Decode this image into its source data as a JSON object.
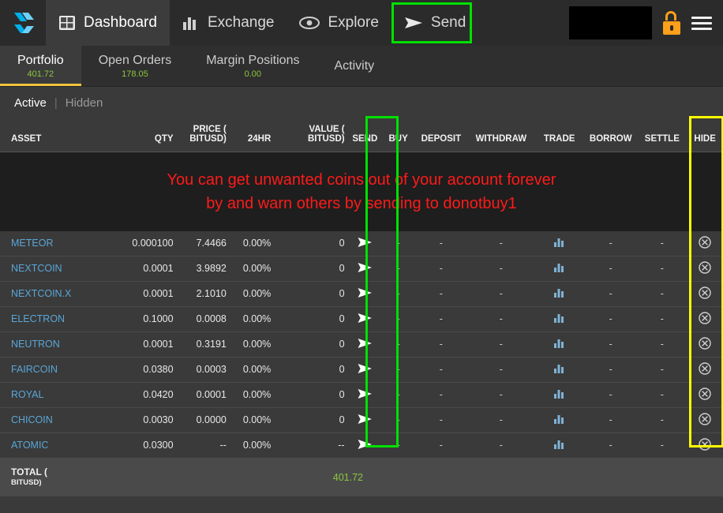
{
  "topbar": {
    "logo_icon": "bitshares-logo-icon",
    "nav": [
      {
        "label": "Dashboard",
        "icon": "dashboard-icon",
        "active": true
      },
      {
        "label": "Exchange",
        "icon": "bar-chart-icon",
        "active": false
      },
      {
        "label": "Explore",
        "icon": "eye-icon",
        "active": false
      },
      {
        "label": "Send",
        "icon": "send-arrow-icon",
        "active": false,
        "highlight": "#00e000"
      }
    ],
    "account_box": "",
    "lock_icon": "unlocked-padlock-icon",
    "menu_icon": "hamburger-menu-icon"
  },
  "tabs": [
    {
      "label": "Portfolio",
      "value": "401.72",
      "active": true
    },
    {
      "label": "Open Orders",
      "value": "178.05",
      "active": false
    },
    {
      "label": "Margin Positions",
      "value": "0.00",
      "active": false
    },
    {
      "label": "Activity",
      "value": "",
      "active": false
    }
  ],
  "subtabs": {
    "items": [
      {
        "label": "Active",
        "active": true
      },
      {
        "label": "Hidden",
        "active": false
      }
    ],
    "separator": "|"
  },
  "banner": {
    "line1": "You can get unwanted coins out of your account forever",
    "line2": "by and warn others by sending to  donotbuy1",
    "color": "#ff1a1a"
  },
  "table": {
    "columns": [
      {
        "key": "asset",
        "label": "ASSET",
        "align": "left"
      },
      {
        "key": "qty",
        "label": "QTY",
        "align": "right"
      },
      {
        "key": "price",
        "label": "PRICE (",
        "label2": "BITUSD)",
        "align": "right"
      },
      {
        "key": "hr24",
        "label": "24HR",
        "align": "right"
      },
      {
        "key": "value",
        "label": "VALUE (",
        "label2": "BITUSD)",
        "align": "right"
      },
      {
        "key": "send",
        "label": "SEND",
        "align": "center"
      },
      {
        "key": "buy",
        "label": "BUY",
        "align": "center"
      },
      {
        "key": "deposit",
        "label": "DEPOSIT",
        "align": "center"
      },
      {
        "key": "withdraw",
        "label": "WITHDRAW",
        "align": "center"
      },
      {
        "key": "trade",
        "label": "TRADE",
        "align": "center"
      },
      {
        "key": "borrow",
        "label": "BORROW",
        "align": "center"
      },
      {
        "key": "settle",
        "label": "SETTLE",
        "align": "center"
      },
      {
        "key": "hide",
        "label": "HIDE",
        "align": "center"
      }
    ],
    "rows": [
      {
        "asset": "METEOR",
        "qty": "0.000100",
        "price": "7.4466",
        "hr24": "0.00%",
        "value": "0",
        "send": "send-arrow-icon",
        "buy": "-",
        "deposit": "-",
        "withdraw": "-",
        "trade": "chart-icon",
        "borrow": "-",
        "settle": "-",
        "hide": "hide-circle-icon"
      },
      {
        "asset": "NEXTCOIN",
        "qty": "0.0001",
        "price": "3.9892",
        "hr24": "0.00%",
        "value": "0",
        "send": "send-arrow-icon",
        "buy": "-",
        "deposit": "-",
        "withdraw": "-",
        "trade": "chart-icon",
        "borrow": "-",
        "settle": "-",
        "hide": "hide-circle-icon"
      },
      {
        "asset": "NEXTCOIN.X",
        "qty": "0.0001",
        "price": "2.1010",
        "hr24": "0.00%",
        "value": "0",
        "send": "send-arrow-icon",
        "buy": "-",
        "deposit": "-",
        "withdraw": "-",
        "trade": "chart-icon",
        "borrow": "-",
        "settle": "-",
        "hide": "hide-circle-icon"
      },
      {
        "asset": "ELECTRON",
        "qty": "0.1000",
        "price": "0.0008",
        "hr24": "0.00%",
        "value": "0",
        "send": "send-arrow-icon",
        "buy": "-",
        "deposit": "-",
        "withdraw": "-",
        "trade": "chart-icon",
        "borrow": "-",
        "settle": "-",
        "hide": "hide-circle-icon"
      },
      {
        "asset": "NEUTRON",
        "qty": "0.0001",
        "price": "0.3191",
        "hr24": "0.00%",
        "value": "0",
        "send": "send-arrow-icon",
        "buy": "-",
        "deposit": "-",
        "withdraw": "-",
        "trade": "chart-icon",
        "borrow": "-",
        "settle": "-",
        "hide": "hide-circle-icon"
      },
      {
        "asset": "FAIRCOIN",
        "qty": "0.0380",
        "price": "0.0003",
        "hr24": "0.00%",
        "value": "0",
        "send": "send-arrow-icon",
        "buy": "-",
        "deposit": "-",
        "withdraw": "-",
        "trade": "chart-icon",
        "borrow": "-",
        "settle": "-",
        "hide": "hide-circle-icon"
      },
      {
        "asset": "ROYAL",
        "qty": "0.0420",
        "price": "0.0001",
        "hr24": "0.00%",
        "value": "0",
        "send": "send-arrow-icon",
        "buy": "-",
        "deposit": "-",
        "withdraw": "-",
        "trade": "chart-icon",
        "borrow": "-",
        "settle": "-",
        "hide": "hide-circle-icon"
      },
      {
        "asset": "CHICOIN",
        "qty": "0.0030",
        "price": "0.0000",
        "hr24": "0.00%",
        "value": "0",
        "send": "send-arrow-icon",
        "buy": "-",
        "deposit": "-",
        "withdraw": "-",
        "trade": "chart-icon",
        "borrow": "-",
        "settle": "-",
        "hide": "hide-circle-icon"
      },
      {
        "asset": "ATOMIC",
        "qty": "0.0300",
        "price": "--",
        "hr24": "0.00%",
        "value": "--",
        "send": "send-arrow-icon",
        "buy": "-",
        "deposit": "-",
        "withdraw": "-",
        "trade": "chart-icon",
        "borrow": "-",
        "settle": "-",
        "hide": "hide-circle-icon"
      }
    ]
  },
  "total": {
    "label": "TOTAL (",
    "label2": "BITUSD)",
    "value": "401.72"
  },
  "highlights": {
    "send_column_color": "#00e000",
    "hide_column_color": "#ffff00"
  }
}
